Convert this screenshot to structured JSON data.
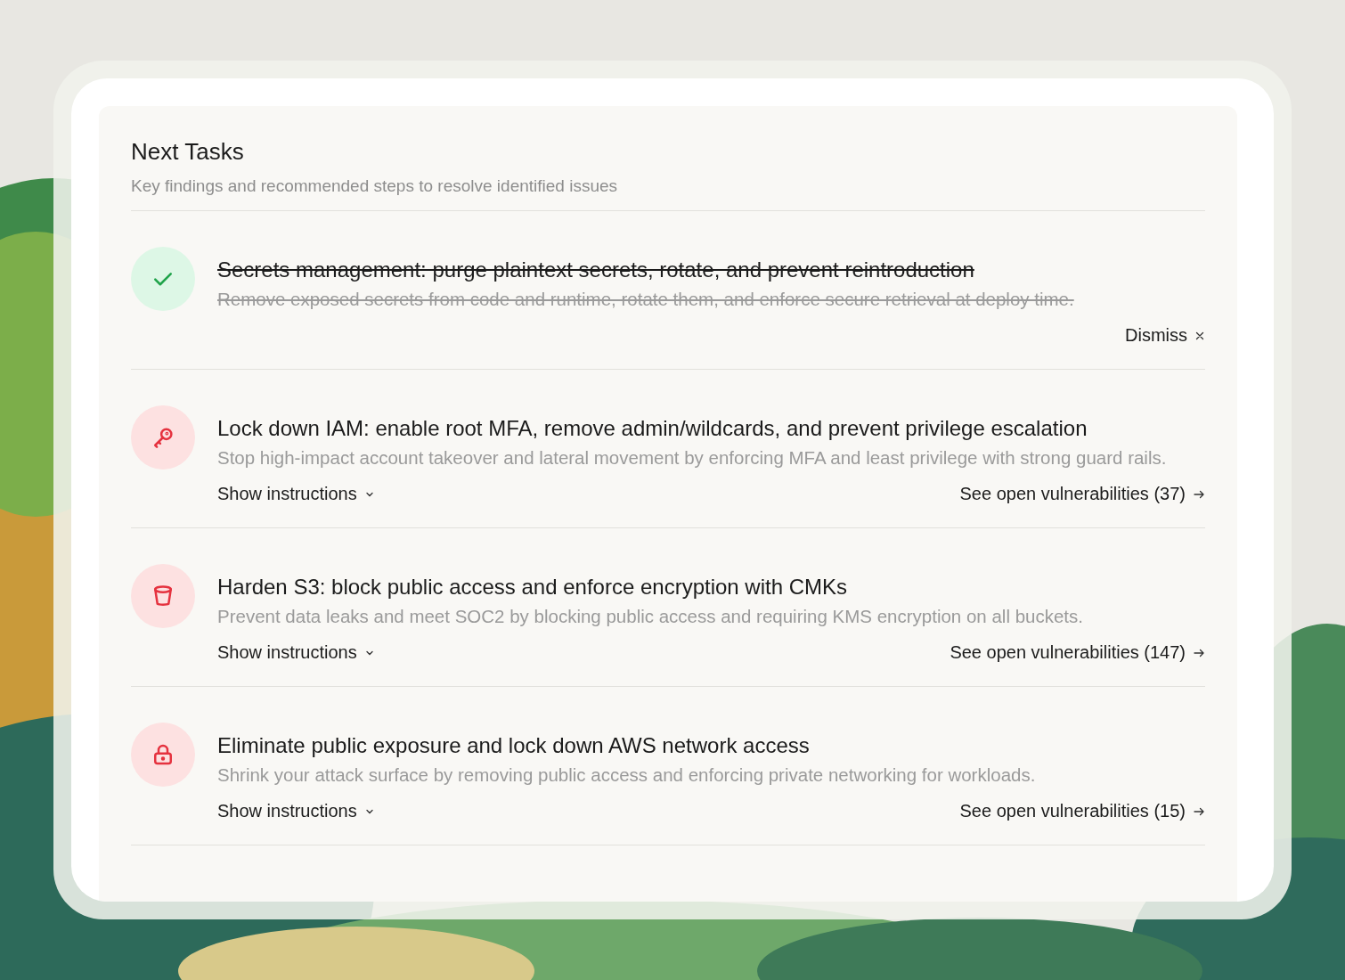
{
  "panel": {
    "title": "Next Tasks",
    "subtitle": "Key findings and recommended steps to resolve identified issues"
  },
  "tasks": [
    {
      "kind": "check",
      "completed": true,
      "title": "Secrets management: purge plaintext secrets, rotate, and prevent reintroduction",
      "description": "Remove exposed secrets from code and runtime, rotate them, and enforce secure retrieval at deploy time.",
      "dismiss": "Dismiss"
    },
    {
      "kind": "key",
      "completed": false,
      "title": "Lock down IAM: enable root MFA, remove admin/wildcards, and prevent privilege escalation",
      "description": "Stop high-impact account takeover and lateral movement by enforcing MFA and least privilege with strong guard rails.",
      "instructions": "Show instructions",
      "vulnerabilities": "See open vulnerabilities (37)"
    },
    {
      "kind": "bucket",
      "completed": false,
      "title": "Harden S3: block public access and enforce encryption with CMKs",
      "description": "Prevent data leaks and meet SOC2 by blocking public access and requiring KMS encryption on all buckets.",
      "instructions": "Show instructions",
      "vulnerabilities": "See open vulnerabilities (147)"
    },
    {
      "kind": "lock",
      "completed": false,
      "title": "Eliminate public exposure and lock down AWS network access",
      "description": "Shrink your attack surface by removing public access and enforcing private networking for workloads.",
      "instructions": "Show instructions",
      "vulnerabilities": "See open vulnerabilities (15)"
    }
  ]
}
